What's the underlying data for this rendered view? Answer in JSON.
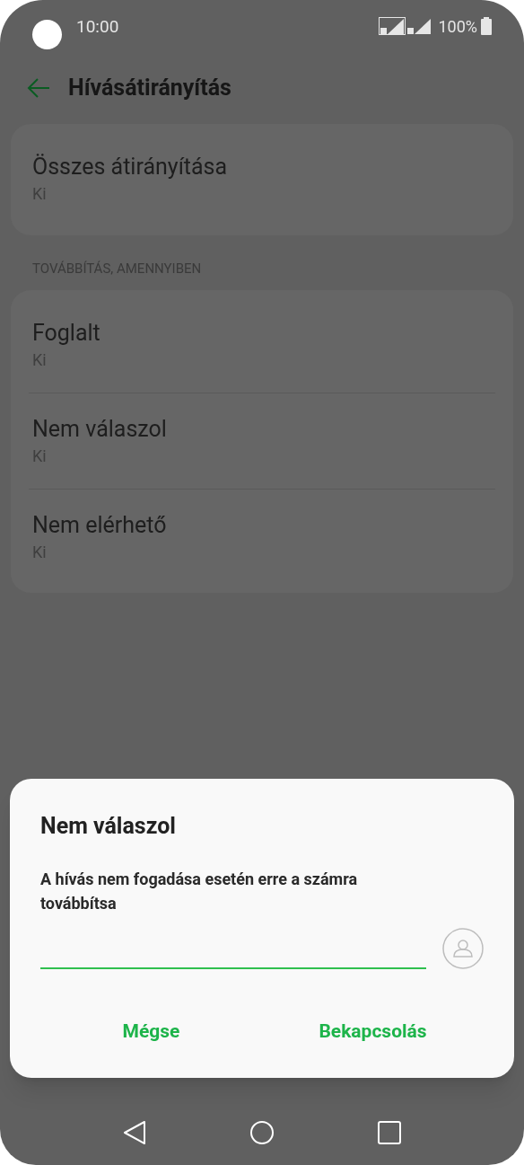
{
  "status_bar": {
    "time": "10:00",
    "battery": "100%"
  },
  "header": {
    "title": "Hívásátirányítás"
  },
  "main_card": {
    "title": "Összes átirányítása",
    "value": "Ki"
  },
  "section": {
    "heading": "TOVÁBBÍTÁS, AMENNYIBEN",
    "items": [
      {
        "title": "Foglalt",
        "value": "Ki"
      },
      {
        "title": "Nem válaszol",
        "value": "Ki"
      },
      {
        "title": "Nem elérhető",
        "value": "Ki"
      }
    ]
  },
  "dialog": {
    "title": "Nem válaszol",
    "message": "A hívás nem fogadása esetén erre a számra továbbítsa",
    "buttons": [
      "Mégse",
      "Bekapcsolás"
    ]
  }
}
